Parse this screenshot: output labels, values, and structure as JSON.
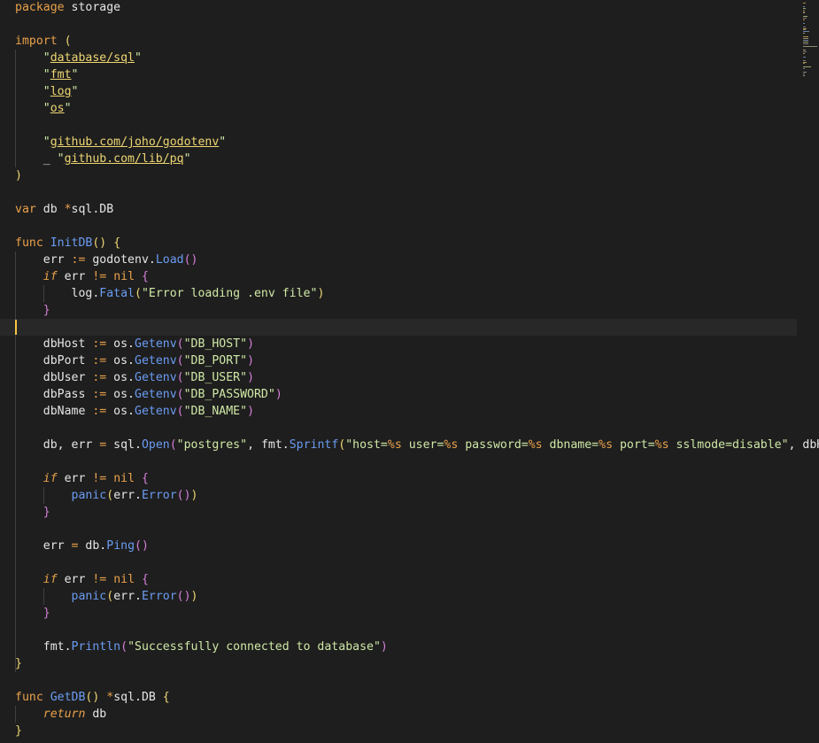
{
  "editor": {
    "language": "go",
    "colors": {
      "background": "#1e1e1e",
      "keyword": "#e9a14b",
      "function": "#6b9cf2",
      "string": "#cfe8a6",
      "import_path": "#eed672",
      "cursor": "#f5c542"
    },
    "lines": [
      {
        "segments": [
          [
            "kw",
            "package"
          ],
          [
            "ident",
            " storage"
          ]
        ]
      },
      {
        "segments": []
      },
      {
        "segments": [
          [
            "kw",
            "import"
          ],
          [
            "ident",
            " "
          ],
          [
            "paren",
            "("
          ]
        ]
      },
      {
        "segments": [
          [
            "ident",
            "    "
          ],
          [
            "strq",
            "\""
          ],
          [
            "imp",
            "database/sql"
          ],
          [
            "strq",
            "\""
          ]
        ]
      },
      {
        "segments": [
          [
            "ident",
            "    "
          ],
          [
            "strq",
            "\""
          ],
          [
            "imp",
            "fmt"
          ],
          [
            "strq",
            "\""
          ]
        ]
      },
      {
        "segments": [
          [
            "ident",
            "    "
          ],
          [
            "strq",
            "\""
          ],
          [
            "imp",
            "log"
          ],
          [
            "strq",
            "\""
          ]
        ]
      },
      {
        "segments": [
          [
            "ident",
            "    "
          ],
          [
            "strq",
            "\""
          ],
          [
            "imp",
            "os"
          ],
          [
            "strq",
            "\""
          ]
        ]
      },
      {
        "segments": []
      },
      {
        "segments": [
          [
            "ident",
            "    "
          ],
          [
            "strq",
            "\""
          ],
          [
            "imp",
            "github.com/joho/godotenv"
          ],
          [
            "strq",
            "\""
          ]
        ]
      },
      {
        "segments": [
          [
            "ident",
            "    _ "
          ],
          [
            "strq",
            "\""
          ],
          [
            "imp",
            "github.com/lib/pq"
          ],
          [
            "strq",
            "\""
          ]
        ]
      },
      {
        "segments": [
          [
            "paren",
            ")"
          ]
        ]
      },
      {
        "segments": []
      },
      {
        "segments": [
          [
            "kw",
            "var"
          ],
          [
            "ident",
            " db "
          ],
          [
            "op",
            "*"
          ],
          [
            "ident",
            "sql.DB"
          ]
        ]
      },
      {
        "segments": []
      },
      {
        "segments": [
          [
            "kw",
            "func"
          ],
          [
            "ident",
            " "
          ],
          [
            "fnd",
            "InitDB"
          ],
          [
            "paren",
            "()"
          ],
          [
            "ident",
            " "
          ],
          [
            "paren",
            "{"
          ]
        ]
      },
      {
        "segments": [
          [
            "ident",
            "    err "
          ],
          [
            "op",
            ":="
          ],
          [
            "ident",
            " godotenv."
          ],
          [
            "fn",
            "Load"
          ],
          [
            "paren2",
            "()"
          ]
        ]
      },
      {
        "segments": [
          [
            "ident",
            "    "
          ],
          [
            "kwi",
            "if"
          ],
          [
            "ident",
            " err "
          ],
          [
            "op",
            "!="
          ],
          [
            "ident",
            " "
          ],
          [
            "nil",
            "nil"
          ],
          [
            "ident",
            " "
          ],
          [
            "paren2",
            "{"
          ]
        ]
      },
      {
        "segments": [
          [
            "ident",
            "        log."
          ],
          [
            "fn",
            "Fatal"
          ],
          [
            "paren",
            "("
          ],
          [
            "str",
            "\"Error loading .env file\""
          ],
          [
            "paren",
            ")"
          ]
        ]
      },
      {
        "segments": [
          [
            "ident",
            "    "
          ],
          [
            "paren2",
            "}"
          ]
        ]
      },
      {
        "segments": [],
        "current": true
      },
      {
        "segments": [
          [
            "ident",
            "    dbHost "
          ],
          [
            "op",
            ":="
          ],
          [
            "ident",
            " os."
          ],
          [
            "fn",
            "Getenv"
          ],
          [
            "paren2",
            "("
          ],
          [
            "str",
            "\"DB_HOST\""
          ],
          [
            "paren2",
            ")"
          ]
        ]
      },
      {
        "segments": [
          [
            "ident",
            "    dbPort "
          ],
          [
            "op",
            ":="
          ],
          [
            "ident",
            " os."
          ],
          [
            "fn",
            "Getenv"
          ],
          [
            "paren2",
            "("
          ],
          [
            "str",
            "\"DB_PORT\""
          ],
          [
            "paren2",
            ")"
          ]
        ]
      },
      {
        "segments": [
          [
            "ident",
            "    dbUser "
          ],
          [
            "op",
            ":="
          ],
          [
            "ident",
            " os."
          ],
          [
            "fn",
            "Getenv"
          ],
          [
            "paren2",
            "("
          ],
          [
            "str",
            "\"DB_USER\""
          ],
          [
            "paren2",
            ")"
          ]
        ]
      },
      {
        "segments": [
          [
            "ident",
            "    dbPass "
          ],
          [
            "op",
            ":="
          ],
          [
            "ident",
            " os."
          ],
          [
            "fn",
            "Getenv"
          ],
          [
            "paren2",
            "("
          ],
          [
            "str",
            "\"DB_PASSWORD\""
          ],
          [
            "paren2",
            ")"
          ]
        ]
      },
      {
        "segments": [
          [
            "ident",
            "    dbName "
          ],
          [
            "op",
            ":="
          ],
          [
            "ident",
            " os."
          ],
          [
            "fn",
            "Getenv"
          ],
          [
            "paren2",
            "("
          ],
          [
            "str",
            "\"DB_NAME\""
          ],
          [
            "paren2",
            ")"
          ]
        ]
      },
      {
        "segments": []
      },
      {
        "segments": [
          [
            "ident",
            "    db, err "
          ],
          [
            "op",
            "="
          ],
          [
            "ident",
            " sql."
          ],
          [
            "fn",
            "Open"
          ],
          [
            "paren2",
            "("
          ],
          [
            "str",
            "\"postgres\""
          ],
          [
            "ident",
            ", fmt."
          ],
          [
            "fn",
            "Sprintf"
          ],
          [
            "paren",
            "("
          ],
          [
            "str",
            "\"host="
          ],
          [
            "op",
            "%s"
          ],
          [
            "str",
            " user="
          ],
          [
            "op",
            "%s"
          ],
          [
            "str",
            " password="
          ],
          [
            "op",
            "%s"
          ],
          [
            "str",
            " dbname="
          ],
          [
            "op",
            "%s"
          ],
          [
            "str",
            " port="
          ],
          [
            "op",
            "%s"
          ],
          [
            "str",
            " sslmode=disable\""
          ],
          [
            "ident",
            ", dbH"
          ]
        ]
      },
      {
        "segments": []
      },
      {
        "segments": [
          [
            "ident",
            "    "
          ],
          [
            "kwi",
            "if"
          ],
          [
            "ident",
            " err "
          ],
          [
            "op",
            "!="
          ],
          [
            "ident",
            " "
          ],
          [
            "nil",
            "nil"
          ],
          [
            "ident",
            " "
          ],
          [
            "paren2",
            "{"
          ]
        ]
      },
      {
        "segments": [
          [
            "ident",
            "        "
          ],
          [
            "fn",
            "panic"
          ],
          [
            "paren",
            "("
          ],
          [
            "ident",
            "err."
          ],
          [
            "fn",
            "Error"
          ],
          [
            "paren2",
            "()"
          ],
          [
            "paren",
            ")"
          ]
        ]
      },
      {
        "segments": [
          [
            "ident",
            "    "
          ],
          [
            "paren2",
            "}"
          ]
        ]
      },
      {
        "segments": []
      },
      {
        "segments": [
          [
            "ident",
            "    err "
          ],
          [
            "op",
            "="
          ],
          [
            "ident",
            " db."
          ],
          [
            "fn",
            "Ping"
          ],
          [
            "paren2",
            "()"
          ]
        ]
      },
      {
        "segments": []
      },
      {
        "segments": [
          [
            "ident",
            "    "
          ],
          [
            "kwi",
            "if"
          ],
          [
            "ident",
            " err "
          ],
          [
            "op",
            "!="
          ],
          [
            "ident",
            " "
          ],
          [
            "nil",
            "nil"
          ],
          [
            "ident",
            " "
          ],
          [
            "paren2",
            "{"
          ]
        ]
      },
      {
        "segments": [
          [
            "ident",
            "        "
          ],
          [
            "fn",
            "panic"
          ],
          [
            "paren",
            "("
          ],
          [
            "ident",
            "err."
          ],
          [
            "fn",
            "Error"
          ],
          [
            "paren2",
            "()"
          ],
          [
            "paren",
            ")"
          ]
        ]
      },
      {
        "segments": [
          [
            "ident",
            "    "
          ],
          [
            "paren2",
            "}"
          ]
        ]
      },
      {
        "segments": []
      },
      {
        "segments": [
          [
            "ident",
            "    fmt."
          ],
          [
            "fn",
            "Println"
          ],
          [
            "paren2",
            "("
          ],
          [
            "str",
            "\"Successfully connected to database\""
          ],
          [
            "paren2",
            ")"
          ]
        ]
      },
      {
        "segments": [
          [
            "paren",
            "}"
          ]
        ]
      },
      {
        "segments": []
      },
      {
        "segments": [
          [
            "kw",
            "func"
          ],
          [
            "ident",
            " "
          ],
          [
            "fnd",
            "GetDB"
          ],
          [
            "paren",
            "()"
          ],
          [
            "ident",
            " "
          ],
          [
            "op",
            "*"
          ],
          [
            "ident",
            "sql.DB "
          ],
          [
            "paren",
            "{"
          ]
        ]
      },
      {
        "segments": [
          [
            "ident",
            "    "
          ],
          [
            "kwi",
            "return"
          ],
          [
            "ident",
            " db"
          ]
        ]
      },
      {
        "segments": [
          [
            "paren",
            "}"
          ]
        ]
      }
    ]
  }
}
